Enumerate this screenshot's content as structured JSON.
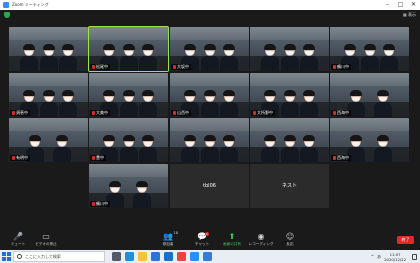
{
  "window": {
    "title": "Zoom ミーティング",
    "controls": [
      "–",
      "□",
      "✕"
    ]
  },
  "meeting": {
    "view_label": "▦ 表示",
    "participants": [
      {
        "name": "",
        "mic_off": false,
        "people": 3,
        "active": false
      },
      {
        "name": "松尾中",
        "mic_off": true,
        "people": 3,
        "active": true
      },
      {
        "name": "大坂中",
        "mic_off": true,
        "people": 3,
        "active": false
      },
      {
        "name": "",
        "mic_off": false,
        "people": 3,
        "active": false
      },
      {
        "name": "鶴川中",
        "mic_off": true,
        "people": 3,
        "active": false
      },
      {
        "name": "須恵中",
        "mic_off": true,
        "people": 3,
        "active": false
      },
      {
        "name": "大美中",
        "mic_off": true,
        "people": 3,
        "active": false
      },
      {
        "name": "山西中",
        "mic_off": true,
        "people": 3,
        "active": false
      },
      {
        "name": "大所野中",
        "mic_off": true,
        "people": 3,
        "active": false
      },
      {
        "name": "西海中",
        "mic_off": true,
        "people": 2,
        "active": false
      },
      {
        "name": "有明中",
        "mic_off": true,
        "people": 2,
        "active": false
      },
      {
        "name": "豊中",
        "mic_off": true,
        "people": 3,
        "active": false
      },
      {
        "name": "",
        "mic_off": false,
        "people": 3,
        "active": false
      },
      {
        "name": "",
        "mic_off": false,
        "people": 3,
        "active": false
      },
      {
        "name": "西海中",
        "mic_off": true,
        "people": 2,
        "active": false
      },
      {
        "name": "鶴川中",
        "mic_off": true,
        "people": 2,
        "active": false
      }
    ],
    "video_off_tiles": [
      "tbl06",
      "ネスト"
    ]
  },
  "toolbar": {
    "mute_label": "ミュート",
    "video_label": "ビデオの停止",
    "participants_label": "参加者",
    "participants_count": "18",
    "chat_label": "チャット",
    "chat_badge": "1",
    "share_label": "画面の共有",
    "record_label": "レコーディング",
    "reactions_label": "反応",
    "end_label": "終了",
    "colors": {
      "share_green": "#3ec45b",
      "end_red": "#e02828"
    }
  },
  "taskbar": {
    "search_placeholder": "ここに入力して検索",
    "tray_chevron": "^",
    "ime": "あ",
    "time": "11:07",
    "date": "2020/12/22",
    "app_icons": [
      "task-view",
      "edge",
      "explorer",
      "store",
      "mail",
      "chrome",
      "zoom",
      "photos"
    ]
  }
}
